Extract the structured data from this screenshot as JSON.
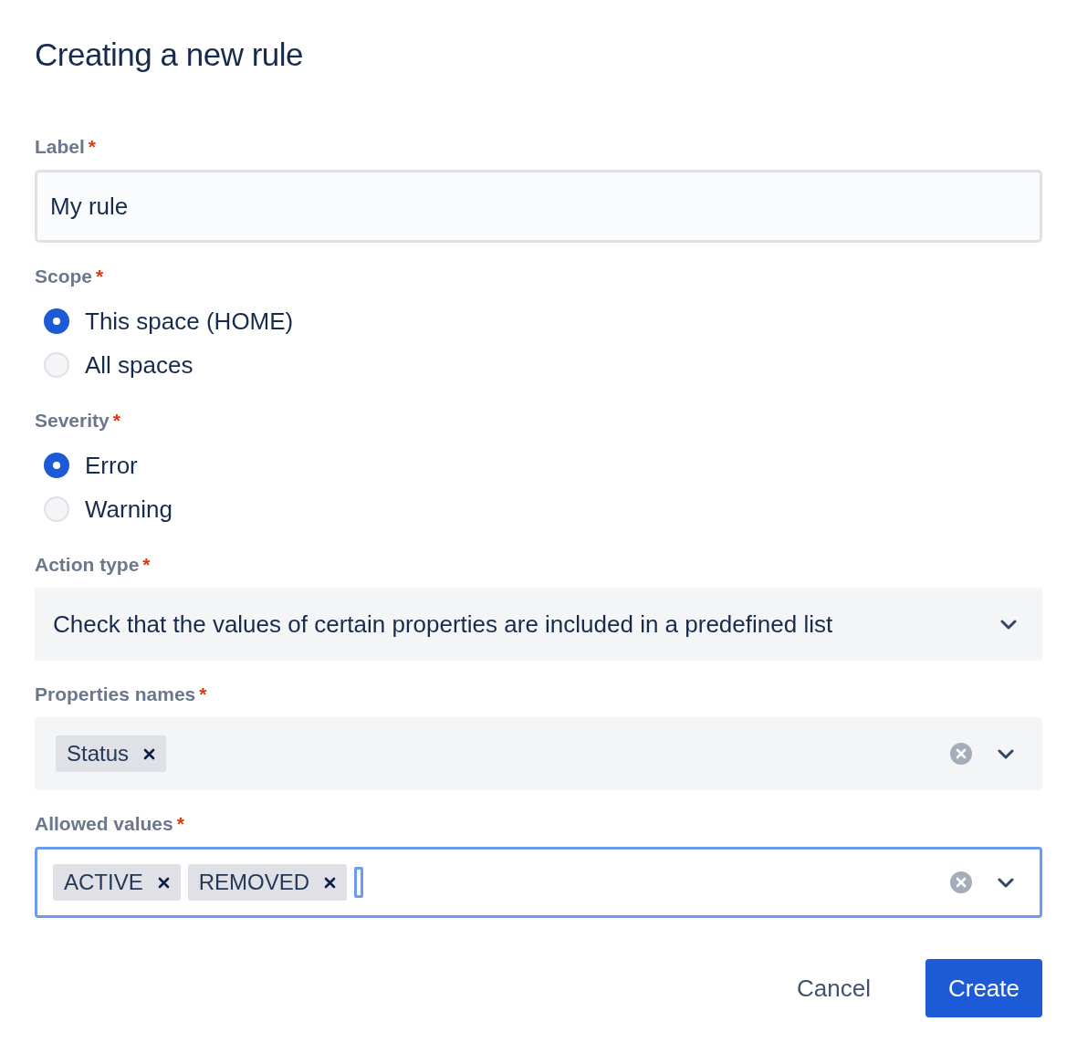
{
  "title": "Creating a new rule",
  "fields": [
    {
      "kind": "text",
      "label": "Label",
      "required_mark": "*",
      "value": "My rule"
    },
    {
      "kind": "radio",
      "label": "Scope",
      "required_mark": "*",
      "options": [
        {
          "label": "This space (HOME)",
          "selected": true
        },
        {
          "label": "All spaces",
          "selected": false
        }
      ]
    },
    {
      "kind": "radio",
      "label": "Severity",
      "required_mark": "*",
      "options": [
        {
          "label": "Error",
          "selected": true
        },
        {
          "label": "Warning",
          "selected": false
        }
      ]
    },
    {
      "kind": "select",
      "label": "Action type",
      "required_mark": "*",
      "value": "Check that the values of certain properties are included in a predefined list"
    },
    {
      "kind": "multiselect",
      "label": "Properties names",
      "required_mark": "*",
      "focused": false,
      "tags": [
        "Status"
      ]
    },
    {
      "kind": "multiselect",
      "label": "Allowed values",
      "required_mark": "*",
      "focused": true,
      "tags": [
        "ACTIVE",
        "REMOVED"
      ]
    }
  ],
  "buttons": [
    {
      "label": "Cancel",
      "kind": "subtle"
    },
    {
      "label": "Create",
      "kind": "primary"
    }
  ]
}
